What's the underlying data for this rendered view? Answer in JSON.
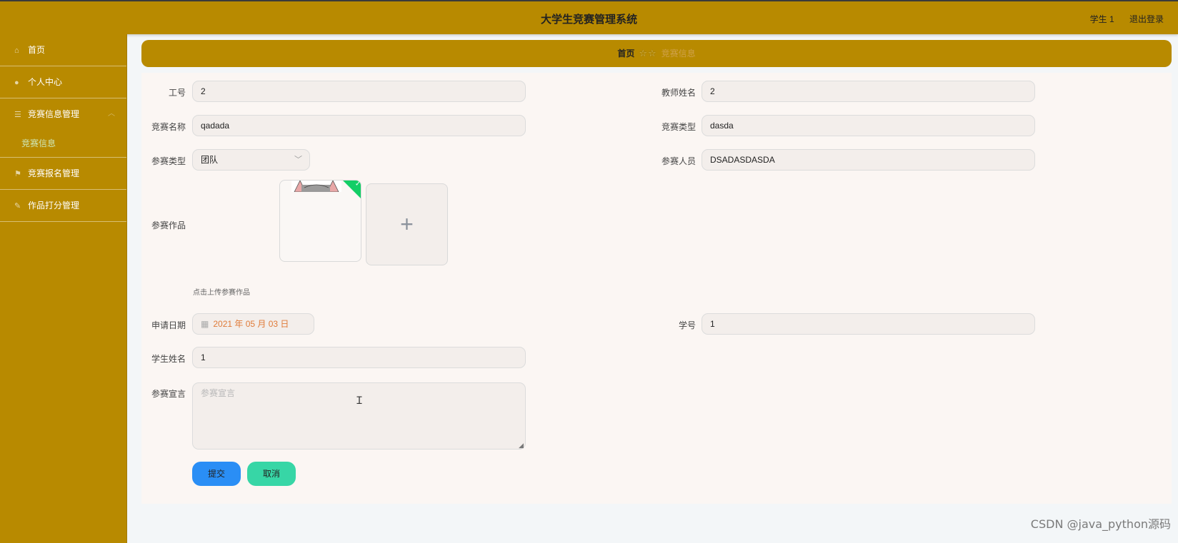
{
  "header": {
    "title": "大学生竞赛管理系统",
    "user": "学生 1",
    "logout": "退出登录"
  },
  "sidebar": {
    "items": [
      {
        "label": "首页",
        "icon": "home-icon"
      },
      {
        "label": "个人中心",
        "icon": "user-icon"
      },
      {
        "label": "竞赛信息管理",
        "icon": "list-icon"
      },
      {
        "label": "竞赛报名管理",
        "icon": "flag-icon"
      },
      {
        "label": "作品打分管理",
        "icon": "edit-icon"
      }
    ],
    "sub_item": "竞赛信息"
  },
  "breadcrumb": {
    "home": "首页",
    "separator": "☆☆",
    "current": "竞赛信息"
  },
  "form": {
    "job_no": {
      "label": "工号",
      "value": "2"
    },
    "teacher_name": {
      "label": "教师姓名",
      "value": "2"
    },
    "contest_name": {
      "label": "竞赛名称",
      "value": "qadada"
    },
    "contest_type": {
      "label": "竞赛类型",
      "value": "dasda"
    },
    "participation_type": {
      "label": "参赛类型",
      "value": "团队"
    },
    "participants": {
      "label": "参赛人员",
      "value": "DSADASDASDA"
    },
    "works": {
      "label": "参赛作品",
      "tip": "点击上传参赛作品"
    },
    "apply_date": {
      "label": "申请日期",
      "value": "2021 年 05 月 03 日"
    },
    "student_no": {
      "label": "学号",
      "value": "1"
    },
    "student_name": {
      "label": "学生姓名",
      "value": "1"
    },
    "declaration": {
      "label": "参赛宣言",
      "placeholder": "参赛宣言"
    },
    "submit": "提交",
    "cancel": "取消"
  },
  "watermark": "CSDN @java_python源码",
  "colors": {
    "header_bg": "#b88a00",
    "submit_bg": "#2a8ef5",
    "cancel_bg": "#37d6a6",
    "date_text": "#e07b39"
  }
}
